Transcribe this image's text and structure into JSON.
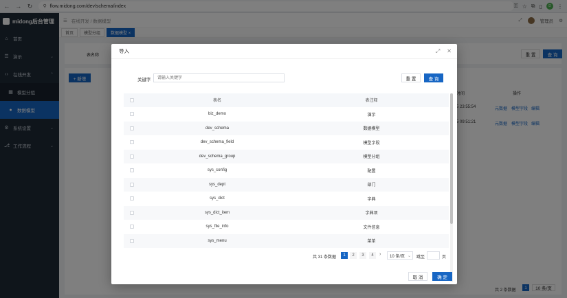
{
  "browser": {
    "url": "flow.midong.com/dev/schema/index",
    "avatar_letter": "D"
  },
  "sidebar": {
    "logo": "midong后台管理",
    "items": [
      {
        "label": "首页",
        "icon": "home-icon"
      },
      {
        "label": "演示",
        "icon": "menu-icon"
      },
      {
        "label": "在线开发",
        "icon": "code-icon"
      },
      {
        "label": "模型分组",
        "icon": "grid-icon"
      },
      {
        "label": "数据模型",
        "icon": "dot-icon"
      },
      {
        "label": "系统设置",
        "icon": "settings-icon"
      },
      {
        "label": "工作流程",
        "icon": "flow-icon"
      }
    ]
  },
  "header": {
    "breadcrumb": "在线开发 / 数据模型",
    "user_name": "管理员"
  },
  "tags": [
    "首页",
    "模型分组",
    "数据模型 ×"
  ],
  "background": {
    "search_label": "表名称",
    "reset_label": "重 置",
    "query_label": "查 询",
    "add_label": "+ 新增",
    "col_time": "时间",
    "col_action": "操作",
    "row1_time": "5 23:55:54",
    "row2_time": "5 09:51:21",
    "action_meta": "元数据",
    "action_field": "模型字段",
    "action_edit": "编辑",
    "total_text": "共 2 条数据",
    "page": "1",
    "page_size": "10 条/页"
  },
  "modal": {
    "title": "导入",
    "search_label": "关键字",
    "search_placeholder": "请输入关键字",
    "reset_label": "重 置",
    "query_label": "查 询",
    "table": {
      "headers": [
        "表名",
        "表注释"
      ],
      "rows": [
        {
          "name": "biz_demo",
          "comment": "演示"
        },
        {
          "name": "dev_schema",
          "comment": "数据模型"
        },
        {
          "name": "dev_schema_field",
          "comment": "模型字段"
        },
        {
          "name": "dev_schema_group",
          "comment": "模型分组"
        },
        {
          "name": "sys_config",
          "comment": "配置"
        },
        {
          "name": "sys_dept",
          "comment": "部门"
        },
        {
          "name": "sys_dict",
          "comment": "字典"
        },
        {
          "name": "sys_dict_item",
          "comment": "字典项"
        },
        {
          "name": "sys_file_info",
          "comment": "文件信息"
        },
        {
          "name": "sys_menu",
          "comment": "菜单"
        }
      ]
    },
    "pagination": {
      "total": "共 31 条数据",
      "pages": [
        "1",
        "2",
        "3",
        "4"
      ],
      "current_page": 1,
      "page_size": "10 条/页",
      "goto_label": "跳至",
      "page_label": "页"
    },
    "cancel_label": "取 消",
    "ok_label": "确 定"
  },
  "colors": {
    "primary": "#1766c4",
    "sidebar": "#1f2a37"
  }
}
